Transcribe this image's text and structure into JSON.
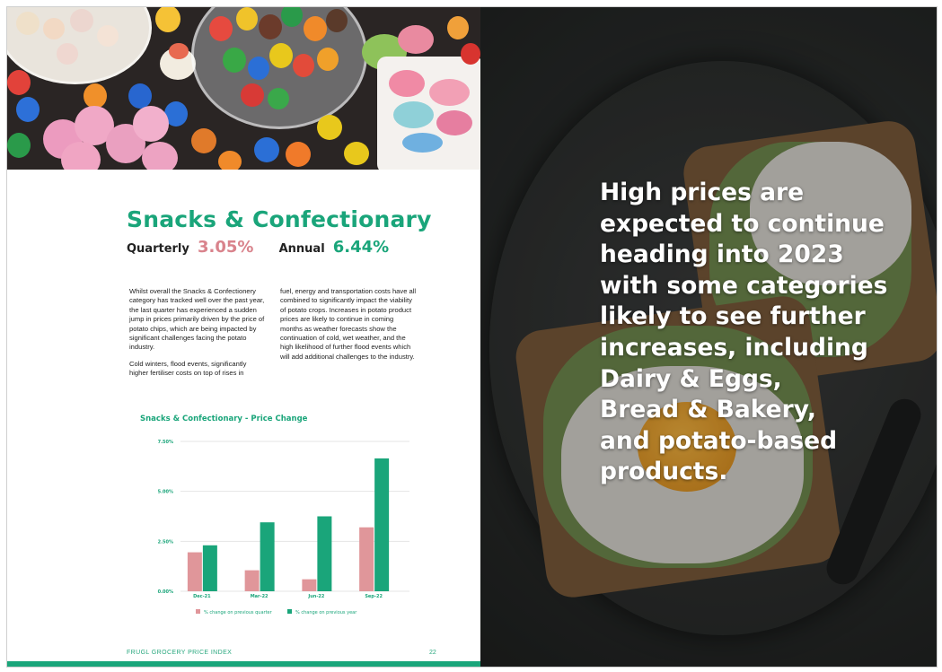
{
  "left_page": {
    "title": "Snacks & Confectionary",
    "quarterly_label": "Quarterly",
    "quarterly_value": "3.05%",
    "annual_label": "Annual",
    "annual_value": "6.44%",
    "body_col1_p1": "Whilst overall the Snacks & Confectionery category has tracked well over the past year, the last quarter has experienced a sudden jump in prices primarily driven by the price of potato chips, which are being impacted by significant challenges facing the potato industry.",
    "body_col1_p2": "Cold winters, flood events, significantly higher fertiliser costs on top of rises in",
    "body_col2_p1": "fuel, energy and transportation costs have all combined to significantly impact the viability of potato crops. Increases in potato product prices are likely to continue in coming months as weather forecasts show the continuation of cold, wet weather, and the high likelihood of further flood events which will add additional challenges to the industry.",
    "footer_text": "FRUGL GROCERY PRICE INDEX",
    "page_number": "22"
  },
  "chart_data": {
    "type": "bar",
    "title": "Snacks & Confectionary - Price Change",
    "categories": [
      "Dec-21",
      "Mar-22",
      "Jun-22",
      "Sep-22"
    ],
    "y_ticks": [
      "0.00%",
      "2.50%",
      "5.00%",
      "7.50%"
    ],
    "ylim": [
      0,
      7.5
    ],
    "grid": true,
    "legend_position": "bottom",
    "series": [
      {
        "name": "% change on previous quarter",
        "color": "#e0969a",
        "values": [
          1.95,
          1.05,
          0.6,
          3.2
        ]
      },
      {
        "name": "% change on previous year",
        "color": "#1aa57a",
        "values": [
          2.3,
          3.45,
          3.75,
          6.65
        ]
      }
    ]
  },
  "right_page": {
    "quote_lines": [
      "High prices are",
      "expected to continue",
      "heading into 2023",
      "with some categories",
      "likely to see further",
      "increases, including",
      "Dairy & Eggs,",
      "Bread & Bakery,",
      "and potato-based",
      "products."
    ]
  },
  "colors": {
    "brand_green": "#1aa57a",
    "quarter_pink": "#e0969a"
  }
}
